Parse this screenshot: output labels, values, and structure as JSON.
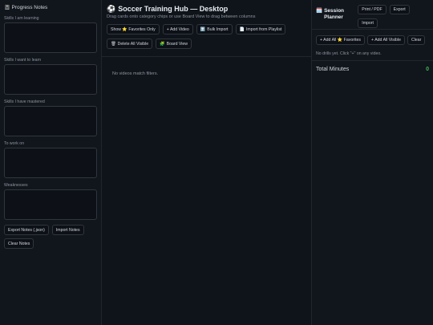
{
  "progress_notes": {
    "title": "Progress Notes",
    "fields": [
      {
        "label": "Skills I am learning"
      },
      {
        "label": "Skills I want to learn"
      },
      {
        "label": "Skills I have mastered"
      },
      {
        "label": "To work on"
      },
      {
        "label": "Weaknesses"
      }
    ],
    "export_label": "Export Notes (.json)",
    "import_label": "Import Notes",
    "clear_label": "Clear Notes"
  },
  "hub": {
    "title": "Soccer Training Hub — Desktop",
    "subtitle": "Drag cards onto category chips or use Board View to drag between columns",
    "buttons": {
      "show_favorites": "Show ⭐ Favorites Only",
      "add_video": "+ Add Video",
      "bulk_import": "Bulk Import",
      "import_playlist": "Import from Playlist",
      "delete_visible": "Delete All Visible",
      "board_view": "Board View"
    },
    "empty_message": "No videos match filters."
  },
  "session_planner": {
    "title": "Session Planner",
    "print_label": "Print / PDF",
    "export_label": "Export",
    "import_label": "Import",
    "add_favorites": "+ Add All ⭐ Favorites",
    "add_visible": "+ Add All Visible",
    "clear_label": "Clear",
    "empty_message": "No drills yet. Click \"+\" on any video.",
    "total_label": "Total Minutes",
    "total_value": "0"
  },
  "colors": {
    "accent_green": "#3fb950"
  }
}
